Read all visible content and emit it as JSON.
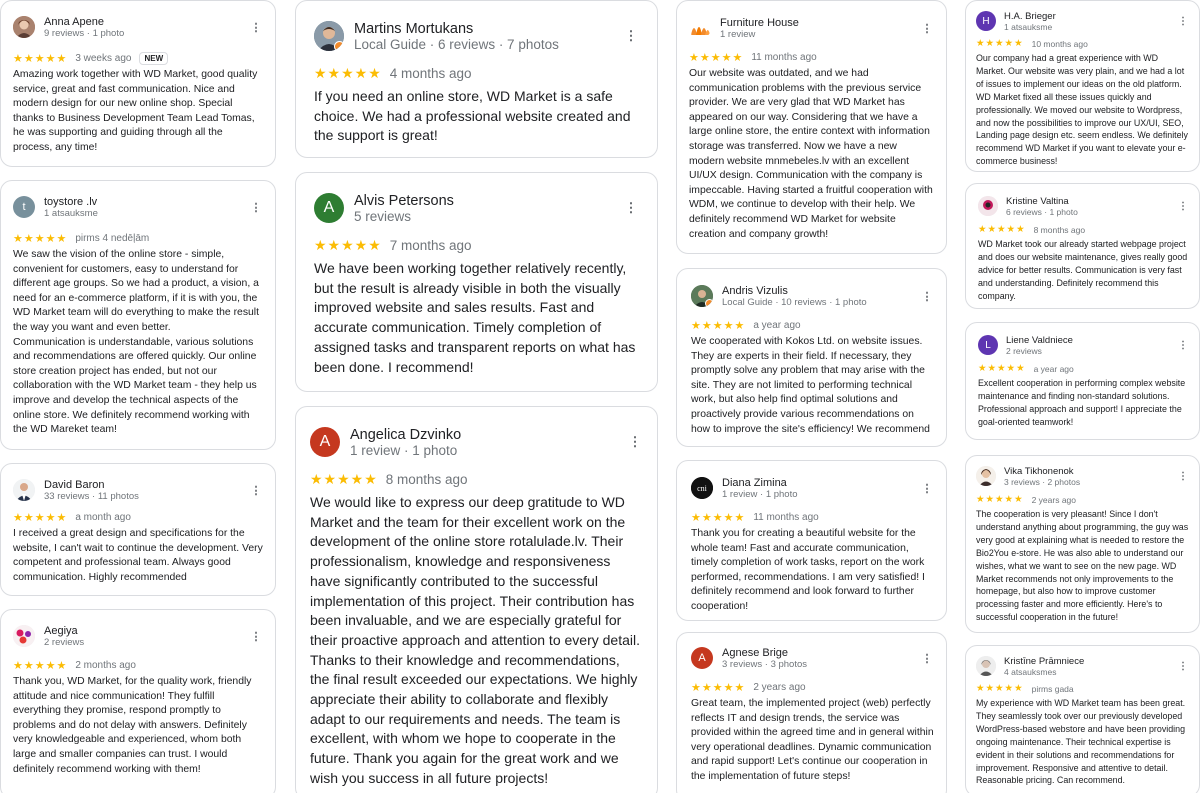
{
  "colors": {
    "star": "#fbbc04",
    "border": "#dadce0",
    "muted": "#70757a"
  },
  "stars": "★★★★★",
  "menu_icon": "⋮",
  "reviews": [
    {
      "name": "Anna Apene",
      "sub": "9 reviews · 1 photo",
      "ago": "3 weeks ago",
      "badge": "NEW",
      "avatar": "photo",
      "text": "Amazing work together with WD Market, good quality service, great and fast communication. Nice and modern design for our new online shop. Special thanks to Business Development Team Lead Tomas, he was supporting and guiding through all the process, any time!"
    },
    {
      "name": "toystore .lv",
      "sub": "1 atsauksme",
      "ago": "pirms 4 nedēļām",
      "avatar": "t",
      "avatar_color": "#78909c",
      "text": "We saw the vision of the online store - simple, convenient for customers, easy to understand for different age groups. So we had a product, a vision, a need for an e-commerce platform, if it is with you, the WD Market team will do everything to make the result the way you want and even better.\nCommunication is understandable, various solutions and recommendations are offered quickly. Our online store creation project has ended, but not our collaboration with the WD Market team - they help us improve and develop the technical aspects of the online store. We definitely recommend working with the WD Mareket team!"
    },
    {
      "name": "David Baron",
      "sub": "33 reviews · 11 photos",
      "ago": "a month ago",
      "avatar": "photo",
      "text": "I received a great design and specifications for the website, I can't wait to continue the development. Very competent and professional team. Always good communication. Highly recommended"
    },
    {
      "name": "Aegiya",
      "sub": "2 reviews",
      "ago": "2 months ago",
      "avatar": "photo",
      "text": "Thank you, WD Market, for the quality work, friendly attitude and nice communication! They fulfill everything they promise, respond promptly to problems and do not delay with answers. Definitely very knowledgeable and experienced, whom both large and smaller companies can trust. I would definitely recommend working with them!"
    },
    {
      "name": "Martins Mortukans",
      "sub": "Local Guide · 6 reviews · 7 photos",
      "ago": "4 months ago",
      "avatar": "photo",
      "text": "If you need an online store, WD Market is a safe choice. We had a professional website created and the support is great!"
    },
    {
      "name": "Alvis Petersons",
      "sub": "5 reviews",
      "ago": "7 months ago",
      "avatar": "A",
      "avatar_color": "#2e7d32",
      "text": "We have been working together relatively recently, but the result is already visible in both the visually improved website and sales results. Fast and accurate communication. Timely completion of assigned tasks and transparent reports on what has been done. I recommend!"
    },
    {
      "name": "Angelica Dzvinko",
      "sub": "1 review · 1 photo",
      "ago": "8 months ago",
      "avatar": "A",
      "avatar_color": "#c5381f",
      "text": "We would like to express our deep gratitude to WD Market and the team for their excellent work on the development of the online store rotalulade.lv. Their professionalism, knowledge and responsiveness have significantly contributed to the successful implementation of this project. Their contribution has been invaluable, and we are especially grateful for their proactive approach and attention to every detail. Thanks to their knowledge and recommendations, the final result exceeded our expectations. We highly appreciate their ability to collaborate and flexibly adapt to our requirements and needs. The team is excellent, with whom we hope to cooperate in the future. Thank you again for the great work and we wish you success in all future projects!"
    },
    {
      "name": "Furniture House",
      "sub": "1 review",
      "ago": "11 months ago",
      "avatar": "photo",
      "text": "Our website was outdated, and we had communication problems with the previous service provider. We are very glad that WD Market has appeared on our way. Considering that we have a large online store, the entire context with information storage was transferred. Now we have a new modern website mnmebeles.lv with an excellent UI/UX design. Communication with the company is impeccable. Having started a fruitful cooperation with WDM, we continue to develop with their help. We definitely recommend WD Market for website creation and company growth!"
    },
    {
      "name": "Andris Vizulis",
      "sub": "Local Guide · 10 reviews · 1 photo",
      "ago": "a year ago",
      "avatar": "photo",
      "text": "We cooperated with Kokos Ltd. on website issues. They are experts in their field. If necessary, they promptly solve any problem that may arise with the site. They are not limited to performing technical work, but also help find optimal solutions and proactively provide various recommendations on how to improve the site's efficiency! We recommend"
    },
    {
      "name": "Diana Zimina",
      "sub": "1 review · 1 photo",
      "ago": "11 months ago",
      "avatar": "photo",
      "text": "Thank you for creating a beautiful website for the whole team! Fast and accurate communication, timely completion of work tasks, report on the work performed, recommendations. I am very satisfied! I definitely recommend and look forward to further cooperation!"
    },
    {
      "name": "Agnese Brige",
      "sub": "3 reviews · 3 photos",
      "ago": "2 years ago",
      "avatar": "A",
      "avatar_color": "#c5381f",
      "text": "Great team, the implemented project (web) perfectly reflects IT and design trends, the service was provided within the agreed time and in general within very operational deadlines. Dynamic communication and rapid support! Let's continue our cooperation in the implementation of future steps!"
    },
    {
      "name": "H.A. Brieger",
      "sub": "1 atsauksme",
      "ago": "10 months ago",
      "avatar": "H",
      "avatar_color": "#5e35b1",
      "text": "Our company had a great experience with WD Market. Our website was very plain, and we had a lot of issues to implement our ideas on the old platform. WD Market fixed all these issues quickly and professionally. We moved our website to Wordpress, and now the possibilities to improve our UX/UI, SEO, Landing page design etc. seem endless. We definitely recommend WD Market if you want to elevate your e-commerce business!"
    },
    {
      "name": "Kristine Valtina",
      "sub": "6 reviews · 1 photo",
      "ago": "8 months ago",
      "avatar": "photo",
      "text": "WD Market took our already started webpage project and does our website maintenance, gives really good advice for better results. Communication is very fast and understanding. Definitely recommend this company."
    },
    {
      "name": "Liene Valdniece",
      "sub": "2 reviews",
      "ago": "a year ago",
      "avatar": "L",
      "avatar_color": "#5e35b1",
      "text": "Excellent cooperation in performing complex website maintenance and finding non-standard solutions. Professional approach and support! I appreciate the goal-oriented teamwork!"
    },
    {
      "name": "Vika Tikhonenok",
      "sub": "3 reviews · 2 photos",
      "ago": "2 years ago",
      "avatar": "photo",
      "text": "The cooperation is very pleasant! Since I don't understand anything about programming, the guy was very good at explaining what is needed to restore the Bio2You e-store. He was also able to understand our wishes, what we want to see on the new page. WD Market recommends not only improvements to the homepage, but also how to improve customer processing faster and more efficiently. Here's to successful cooperation in the future!"
    },
    {
      "name": "Kristīne Prāmniece",
      "sub": "4 atsauksmes",
      "ago": "pirms gada",
      "avatar": "photo",
      "text": "My experience with WD Market team has been great. They seamlessly took over our previously developed WordPress-based webstore and have been providing ongoing maintenance. Their technical expertise is evident in their solutions and recommendations for improvement. Responsive and attentive to detail. Reasonable pricing. Can recommend."
    }
  ]
}
